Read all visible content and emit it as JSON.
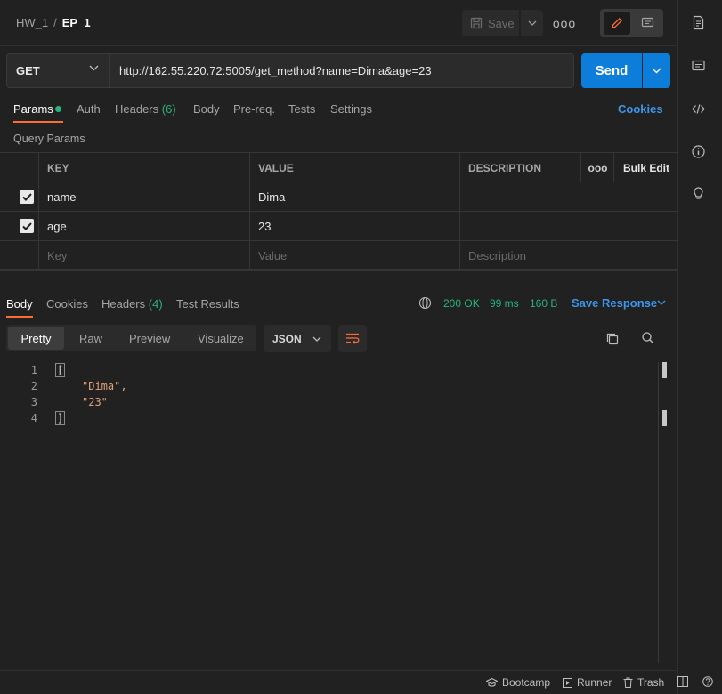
{
  "breadcrumb": {
    "collection": "HW_1",
    "separator": "/",
    "request": "EP_1"
  },
  "toolbar": {
    "save_label": "Save",
    "more": "ooo"
  },
  "request": {
    "method": "GET",
    "url": "http://162.55.220.72:5005/get_method?name=Dima&age=23",
    "send_label": "Send"
  },
  "request_tabs": {
    "params": "Params",
    "auth": "Auth",
    "headers": "Headers",
    "headers_count": "(6)",
    "body": "Body",
    "prereq": "Pre-req.",
    "tests": "Tests",
    "settings": "Settings",
    "cookies": "Cookies"
  },
  "query_params": {
    "label": "Query Params",
    "headers": {
      "key": "KEY",
      "value": "VALUE",
      "description": "DESCRIPTION",
      "more": "ooo",
      "bulk_edit": "Bulk Edit"
    },
    "rows": [
      {
        "key": "name",
        "value": "Dima",
        "description": ""
      },
      {
        "key": "age",
        "value": "23",
        "description": ""
      }
    ],
    "placeholder": {
      "key": "Key",
      "value": "Value",
      "description": "Description"
    }
  },
  "response_tabs": {
    "body": "Body",
    "cookies": "Cookies",
    "headers": "Headers",
    "headers_count": "(4)",
    "test_results": "Test Results"
  },
  "response_meta": {
    "status": "200 OK",
    "time": "99 ms",
    "size": "160 B",
    "save_response": "Save Response"
  },
  "view": {
    "pretty": "Pretty",
    "raw": "Raw",
    "preview": "Preview",
    "visualize": "Visualize",
    "format": "JSON"
  },
  "code_lines": [
    {
      "n": "1",
      "text": "["
    },
    {
      "n": "2",
      "text": "\"Dima\","
    },
    {
      "n": "3",
      "text": "\"23\""
    },
    {
      "n": "4",
      "text": "]"
    }
  ],
  "statusbar": {
    "bootcamp": "Bootcamp",
    "runner": "Runner",
    "trash": "Trash"
  },
  "colors": {
    "accent": "#ff6c37",
    "primary": "#0c7ed9",
    "success": "#26b47f",
    "link": "#3d97ec"
  }
}
